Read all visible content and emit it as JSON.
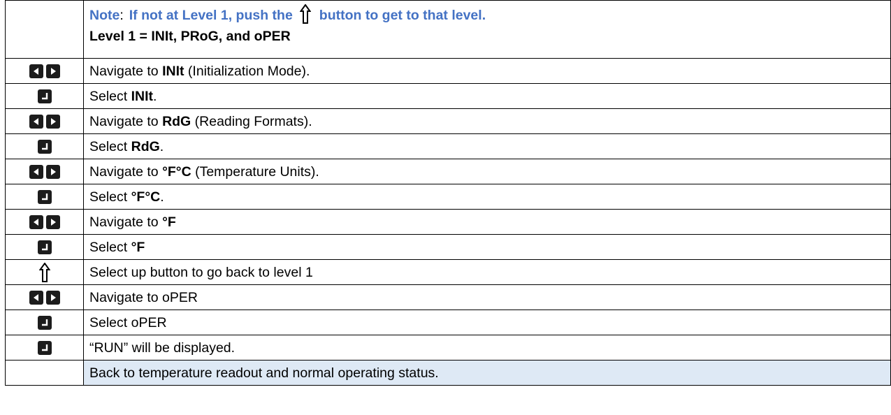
{
  "header": {
    "note_label": "Note",
    "note_colon": ":",
    "note_before_icon": "If not at Level 1, push the",
    "note_after_icon": "button to get to that level.",
    "level_line": "Level 1 = INIt, PRoG, and oPER"
  },
  "icons": {
    "left_right": "left-right-arrow-keys-icon",
    "enter": "enter-key-icon",
    "up": "up-arrow-icon"
  },
  "colors": {
    "note": "#4472c4",
    "row_highlight": "#dee9f5",
    "key": "#1c1c1c"
  },
  "steps": [
    {
      "icon": "left-right",
      "pre": "Navigate to ",
      "bold": "INIt",
      "post": " (Initialization Mode)."
    },
    {
      "icon": "enter",
      "pre": "Select ",
      "bold": "INIt",
      "post": "."
    },
    {
      "icon": "left-right",
      "pre": "Navigate to ",
      "bold": "RdG",
      "post": " (Reading Formats)."
    },
    {
      "icon": "enter",
      "pre": "Select ",
      "bold": "RdG",
      "post": "."
    },
    {
      "icon": "left-right",
      "pre": "Navigate to ",
      "bold": "°F°C",
      "post": " (Temperature Units)."
    },
    {
      "icon": "enter",
      "pre": "Select ",
      "bold": "°F°C",
      "post": "."
    },
    {
      "icon": "left-right",
      "pre": "Navigate to ",
      "bold": "°F",
      "post": ""
    },
    {
      "icon": "enter",
      "pre": "Select ",
      "bold": "°F",
      "post": ""
    },
    {
      "icon": "up",
      "pre": "Select up button to go back to level 1",
      "bold": "",
      "post": ""
    },
    {
      "icon": "left-right",
      "pre": "Navigate to oPER",
      "bold": "",
      "post": ""
    },
    {
      "icon": "enter",
      "pre": "Select oPER",
      "bold": "",
      "post": ""
    },
    {
      "icon": "enter",
      "pre": "“RUN” will be displayed.",
      "bold": "",
      "post": ""
    },
    {
      "icon": "",
      "pre": "Back to temperature readout and normal operating status.",
      "bold": "",
      "post": ""
    }
  ]
}
